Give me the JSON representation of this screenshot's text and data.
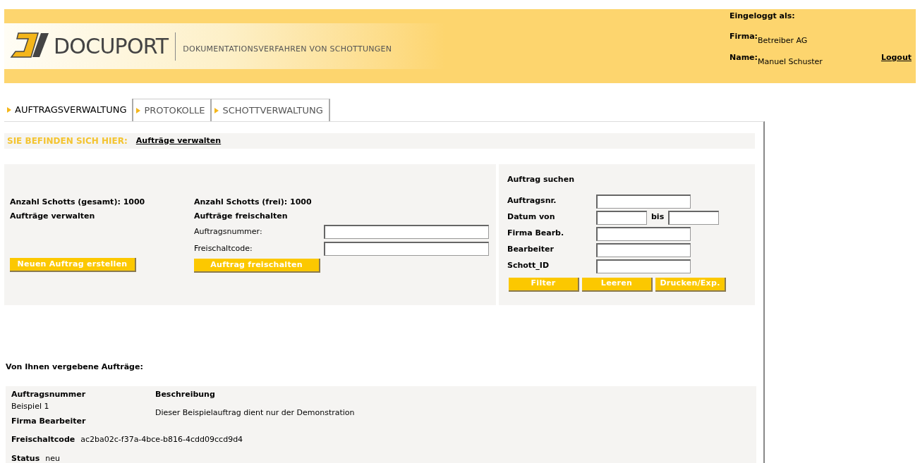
{
  "header": {
    "logo": "DOCUPORT",
    "tagline": "DOKUMENTATIONSVERFAHREN VON SCHOTTUNGEN",
    "login_title": "Eingeloggt als:",
    "company_label": "Firma:",
    "company": "Betreiber AG",
    "name_label": "Name:",
    "name": "Manuel Schuster",
    "logout": "Logout"
  },
  "tabs": [
    {
      "label": "AUFTRAGSVERWALTUNG",
      "selected": true
    },
    {
      "label": "PROTOKOLLE",
      "selected": false
    },
    {
      "label": "SCHOTTVERWALTUNG",
      "selected": false
    }
  ],
  "breadcrumb": {
    "label": "SIE BEFINDEN SICH HIER:",
    "link": "Aufträge verwalten"
  },
  "manage": {
    "count": "Anzahl Schotts (gesamt): 1000",
    "title": "Aufträge verwalten",
    "button": "Neuen Auftrag erstellen"
  },
  "unlock": {
    "count": "Anzahl Schotts (frei): 1000",
    "title": "Aufträge freischalten",
    "fields": [
      {
        "label": "Auftragsnummer:"
      },
      {
        "label": "Freischaltcode:"
      }
    ],
    "button": "Auftrag freischalten"
  },
  "search": {
    "title": "Auftrag suchen",
    "fields": [
      {
        "label": "Auftragsnr.",
        "kind": "single"
      },
      {
        "label": "Datum von",
        "kind": "range",
        "between": "bis"
      },
      {
        "label": "Firma Bearb.",
        "kind": "single"
      },
      {
        "label": "Bearbeiter",
        "kind": "single"
      },
      {
        "label": "Schott_ID",
        "kind": "single"
      }
    ],
    "buttons": [
      "Filter",
      "Leeren",
      "Drucken/Exp."
    ]
  },
  "orders": {
    "title": "Von Ihnen vergebene Aufträge:",
    "col_number": "Auftragsnummer",
    "col_description": "Beschreibung",
    "number": "Beispiel 1",
    "company_label": "Firma Bearbeiter",
    "description": "Dieser Beispielauftrag dient nur der Demonstration",
    "code_label": "Freischaltcode",
    "code": "ac2ba02c-f37a-4bce-b816-4cdd09ccd9d4",
    "status_label": "Status",
    "status": "neu"
  }
}
